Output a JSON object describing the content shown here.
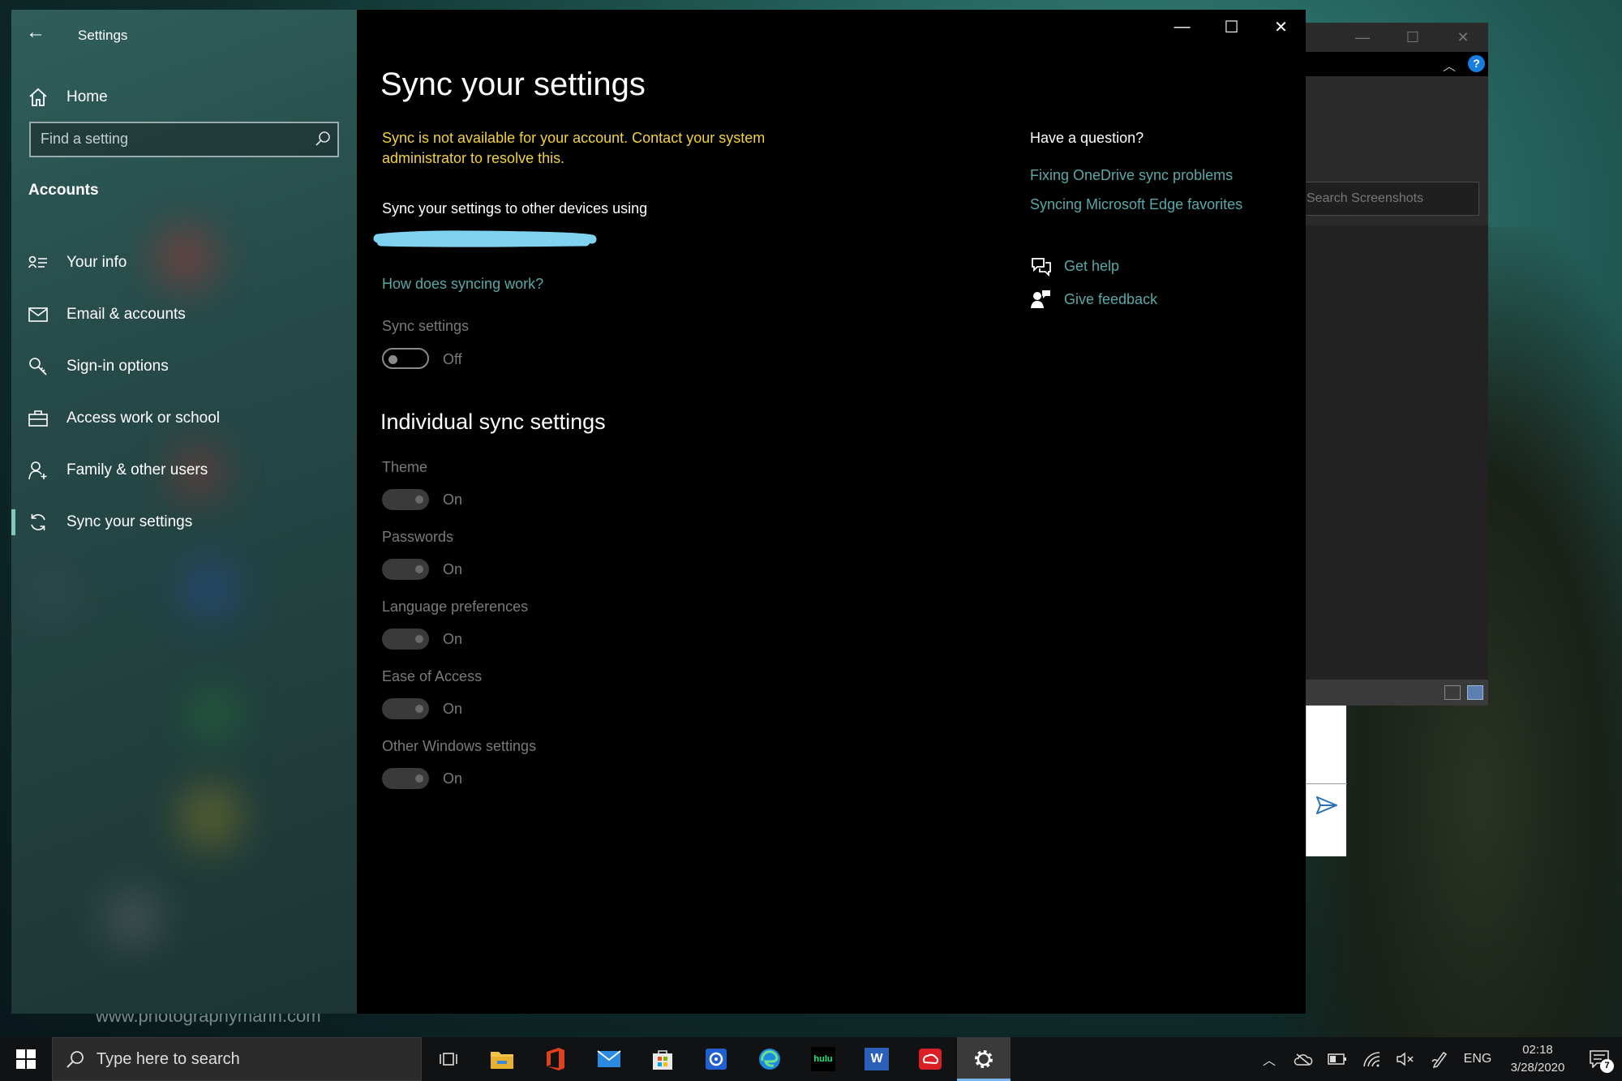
{
  "desktop": {
    "watermark": "www.photographymann.com"
  },
  "bg_window": {
    "search_placeholder": "Search Screenshots",
    "min": "—",
    "max": "☐",
    "close": "✕",
    "help": "?"
  },
  "settings": {
    "app_title": "Settings",
    "nav": {
      "home": "Home",
      "search_placeholder": "Find a setting",
      "section": "Accounts",
      "items": [
        {
          "label": "Your info",
          "icon": "contact-info-icon"
        },
        {
          "label": "Email & accounts",
          "icon": "mail-icon"
        },
        {
          "label": "Sign-in options",
          "icon": "key-icon"
        },
        {
          "label": "Access work or school",
          "icon": "briefcase-icon"
        },
        {
          "label": "Family & other users",
          "icon": "person-add-icon"
        },
        {
          "label": "Sync your settings",
          "icon": "sync-icon",
          "selected": true
        }
      ]
    },
    "page": {
      "title": "Sync your settings",
      "warning": "Sync is not available for your account. Contact your system administrator to resolve this.",
      "sync_using": "Sync your settings to other devices using",
      "how_link": "How does syncing work?",
      "sync_settings_label": "Sync settings",
      "sync_settings_state": "Off",
      "individual_header": "Individual sync settings",
      "individual": [
        {
          "label": "Theme",
          "state": "On"
        },
        {
          "label": "Passwords",
          "state": "On"
        },
        {
          "label": "Language preferences",
          "state": "On"
        },
        {
          "label": "Ease of Access",
          "state": "On"
        },
        {
          "label": "Other Windows settings",
          "state": "On"
        }
      ]
    },
    "aside": {
      "question": "Have a question?",
      "links": [
        "Fixing OneDrive sync problems",
        "Syncing Microsoft Edge favorites"
      ],
      "get_help": "Get help",
      "give_feedback": "Give feedback"
    }
  },
  "taskbar": {
    "search_placeholder": "Type here to search",
    "apps": [
      "task-view",
      "file-explorer",
      "office",
      "mail",
      "microsoft-store",
      "app",
      "edge",
      "hulu",
      "word",
      "creative-cloud",
      "settings"
    ],
    "hulu_label": "hulu",
    "word_label": "W",
    "language": "ENG",
    "time": "02:18",
    "date": "3/28/2020",
    "notification_count": "7"
  },
  "colors": {
    "accent_link": "#59a8a8",
    "warning": "#f2d33a",
    "highlight_scribble": "#7fd3f0"
  }
}
